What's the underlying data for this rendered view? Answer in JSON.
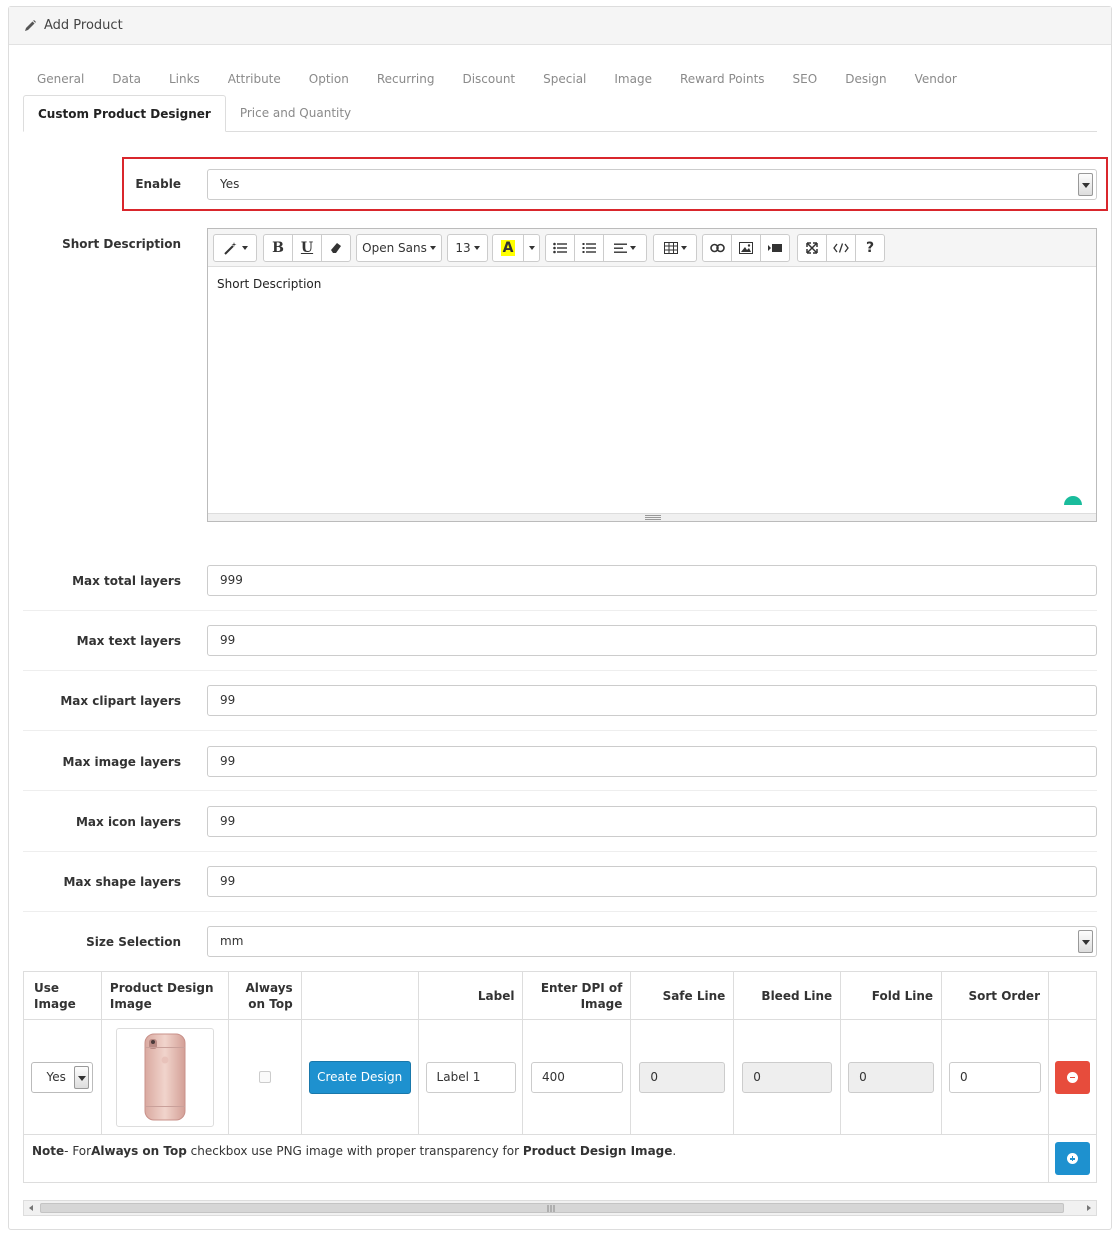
{
  "header": {
    "title": "Add Product"
  },
  "tabs_row1": [
    "General",
    "Data",
    "Links",
    "Attribute",
    "Option",
    "Recurring",
    "Discount",
    "Special",
    "Image",
    "Reward Points",
    "SEO",
    "Design",
    "Vendor"
  ],
  "tabs_row2": [
    "Custom Product Designer",
    "Price and Quantity"
  ],
  "enable": {
    "label": "Enable",
    "value": "Yes"
  },
  "short_description": {
    "label": "Short Description",
    "content": "Short Description",
    "toolbar": {
      "font": "Open Sans",
      "size": "13",
      "color_letter": "A",
      "help": "?"
    }
  },
  "fields": [
    {
      "label": "Max total layers",
      "value": "999"
    },
    {
      "label": "Max text layers",
      "value": "99"
    },
    {
      "label": "Max clipart layers",
      "value": "99"
    },
    {
      "label": "Max image layers",
      "value": "99"
    },
    {
      "label": "Max icon layers",
      "value": "99"
    },
    {
      "label": "Max shape layers",
      "value": "99"
    }
  ],
  "size_selection": {
    "label": "Size Selection",
    "value": "mm"
  },
  "table": {
    "headers": {
      "use_image": "Use Image",
      "design_image_1": "Product Design",
      "design_image_2": "Image",
      "always_top_1": "Always",
      "always_top_2": "on Top",
      "label": "Label",
      "dpi_1": "Enter DPI of",
      "dpi_2": "Image",
      "safe": "Safe Line",
      "bleed": "Bleed Line",
      "fold": "Fold Line",
      "sort": "Sort Order"
    },
    "row": {
      "use_image": "Yes",
      "create_design": "Create Design",
      "label": "Label 1",
      "dpi": "400",
      "safe": "0",
      "bleed": "0",
      "fold": "0",
      "sort": "0"
    },
    "note": {
      "prefix": "Note",
      "text1": "- For",
      "bold1": "Always on Top",
      "text2": " checkbox use PNG image with proper transparency for ",
      "bold2": "Product Design Image",
      "text3": "."
    }
  },
  "colors": {
    "accent_blue": "#1e91cf",
    "danger_red": "#e74c3c",
    "highlight_red": "#d9262c"
  }
}
